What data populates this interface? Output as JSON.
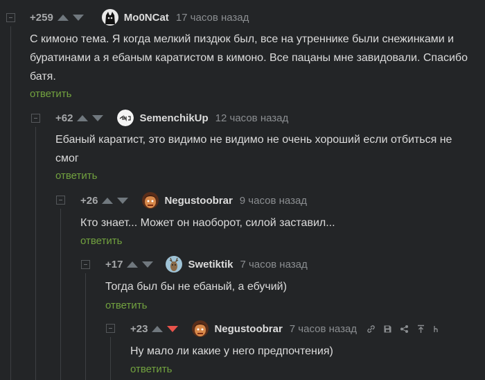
{
  "reply_label": "ответить",
  "colors": {
    "background": "#232527",
    "text": "#dcdcdc",
    "muted": "#8b8e91",
    "reply": "#72a23f",
    "downvote_active": "#e8534b"
  },
  "comments": [
    {
      "rating": "+259",
      "username": "Mo0NCat",
      "time": "17 часов назад",
      "text": "С кимоно тема. Я когда мелкий пиздюк был, все на утреннике были снежинками и буратинами а я ебаным каратистом в кимоно. Все пацаны мне завидовали. Спасибо батя.",
      "avatar_icon": "cat-avatar-icon"
    },
    {
      "rating": "+62",
      "username": "SemenchikUp",
      "time": "12 часов назад",
      "text": "Ебаный каратист, это видимо не видимо не очень хороший если отбиться не смог",
      "avatar_icon": "ing-logo-avatar-icon"
    },
    {
      "rating": "+26",
      "username": "Negustoobrar",
      "time": "9 часов назад",
      "text": "Кто знает... Может он наоборот, силой заставил...",
      "avatar_icon": "cartoon-face-avatar-icon"
    },
    {
      "rating": "+17",
      "username": "Swetiktik",
      "time": "7 часов назад",
      "text": "Тогда был бы не ебаный, а ебучий)",
      "avatar_icon": "deer-avatar-icon"
    },
    {
      "rating": "+23",
      "username": "Negustoobrar",
      "time": "7 часов назад",
      "text": "Ну мало ли какие у него предпочтения)",
      "avatar_icon": "cartoon-face-avatar-icon",
      "downvote_active": true,
      "action_icons": [
        "link-icon",
        "save-icon",
        "share-icon",
        "pin-icon",
        "more-icon"
      ]
    }
  ]
}
